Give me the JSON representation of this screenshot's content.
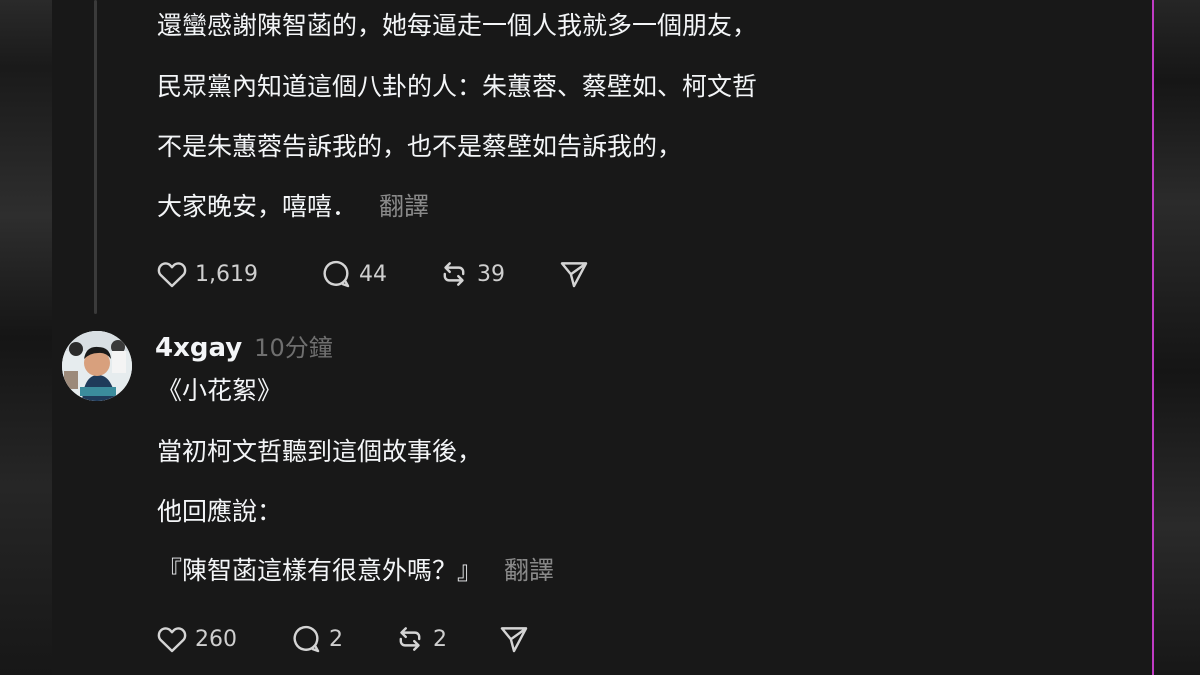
{
  "post1": {
    "lines": [
      "還蠻感謝陳智菡的，她每逼走一個人我就多一個朋友，",
      "民眾黨內知道這個八卦的人：朱蕙蓉、蔡壁如、柯文哲",
      "不是朱蕙蓉告訴我的，也不是蔡壁如告訴我的，",
      "大家晚安，嘻嘻．"
    ],
    "translate_label": "翻譯",
    "actions": {
      "likes": "1,619",
      "replies": "44",
      "reposts": "39"
    }
  },
  "post2": {
    "username": "4xgay",
    "timestamp": "10分鐘",
    "lines": [
      "《小花絮》",
      "當初柯文哲聽到這個故事後，",
      "他回應說：",
      "『陳智菡這樣有很意外嗎？』"
    ],
    "translate_label": "翻譯",
    "actions": {
      "likes": "260",
      "replies": "2",
      "reposts": "2"
    }
  },
  "icons": {
    "like": "heart-icon",
    "reply": "comment-icon",
    "repost": "repost-icon",
    "share": "send-icon"
  },
  "colors": {
    "background": "#181818",
    "text": "#f3f5f7",
    "muted": "#8a8a8a",
    "edge_accent": "#c03bc4"
  }
}
